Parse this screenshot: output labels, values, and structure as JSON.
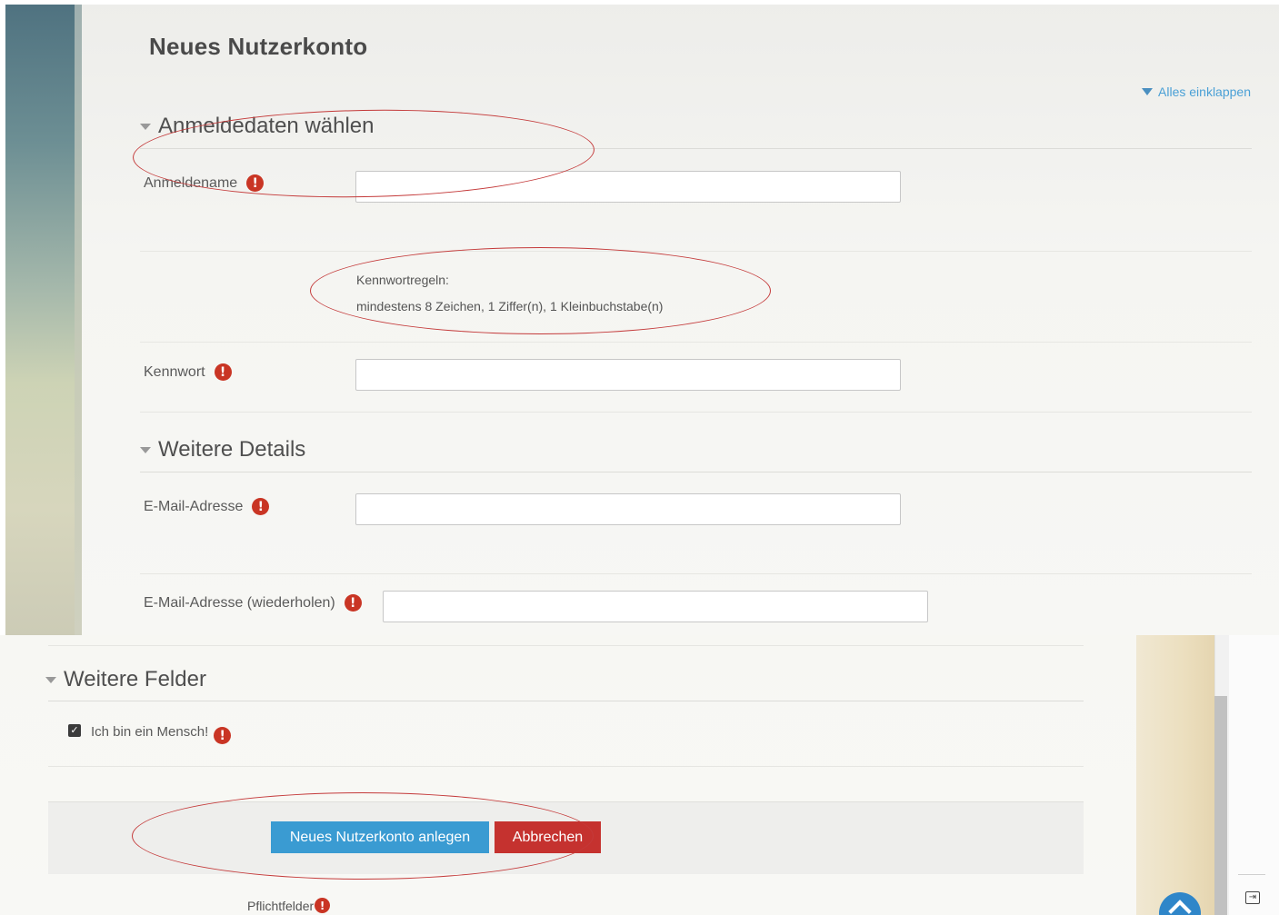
{
  "page_title": "Neues Nutzerkonto",
  "collapse_all": "Alles einklappen",
  "sections": {
    "login": "Anmeldedaten wählen",
    "details": "Weitere Details",
    "fields": "Weitere Felder"
  },
  "fields": {
    "username": {
      "label": "Anmeldename",
      "value": ""
    },
    "password_rules_title": "Kennwortregeln:",
    "password_rules": "mindestens 8 Zeichen, 1 Ziffer(n), 1 Kleinbuchstabe(n)",
    "password": {
      "label": "Kennwort",
      "value": ""
    },
    "email": {
      "label": "E-Mail-Adresse",
      "value": ""
    },
    "email_repeat": {
      "label": "E-Mail-Adresse (wiederholen)",
      "value": ""
    },
    "human_check": {
      "label": "Ich bin ein Mensch!",
      "checked": true
    }
  },
  "buttons": {
    "submit": "Neues Nutzerkonto anlegen",
    "cancel": "Abbrechen"
  },
  "required_note": "Pflichtfelder",
  "required_marker": "!",
  "colors": {
    "primary": "#3a9bd2",
    "danger": "#c5322f",
    "required": "#c93524",
    "link": "#4aa0d6",
    "annotation": "#c43a3a"
  }
}
